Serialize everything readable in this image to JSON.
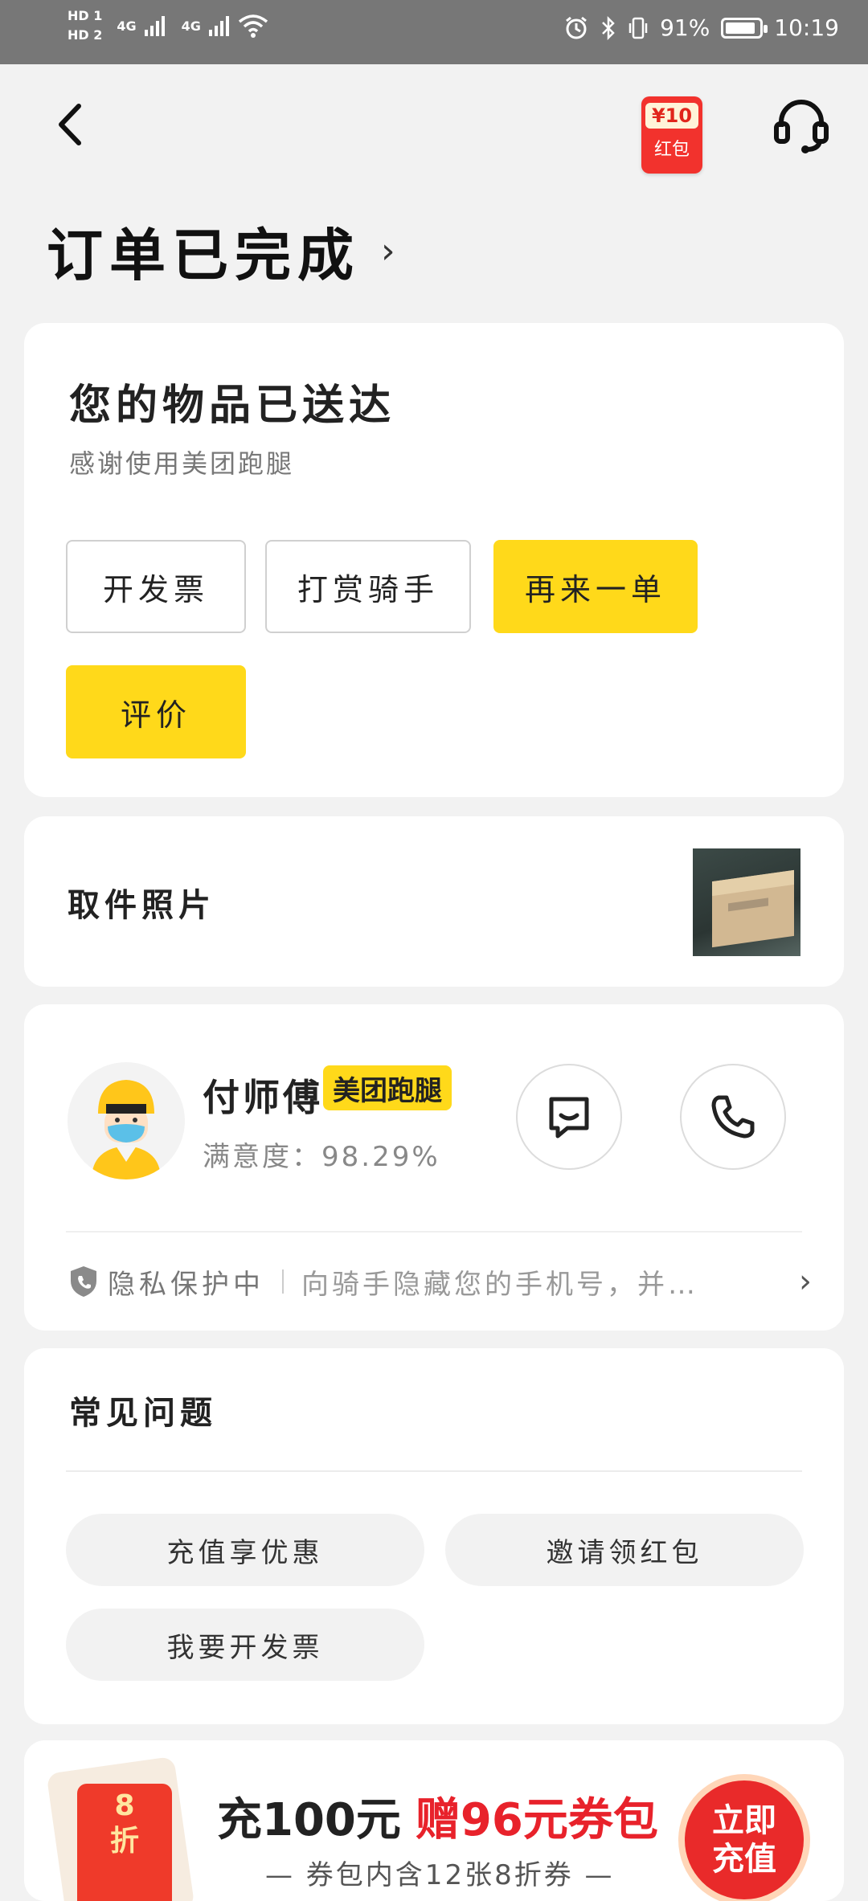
{
  "status_bar": {
    "hd1": "HD 1",
    "hd2": "HD 2",
    "sig1": "4G",
    "sig2": "4G",
    "battery_pct": "91%",
    "battery_level": 0.91,
    "time": "10:19"
  },
  "header": {
    "red_packet_amount": "¥10",
    "red_packet_label": "红包"
  },
  "page_title": "订单已完成",
  "delivery_card": {
    "title": "您的物品已送达",
    "subtitle": "感谢使用美团跑腿",
    "buttons": {
      "invoice": "开发票",
      "tip_rider": "打赏骑手",
      "reorder": "再来一单",
      "review": "评价"
    }
  },
  "pickup_card": {
    "title": "取件照片"
  },
  "rider_card": {
    "name": "付师傅",
    "badge": "美团跑腿",
    "satisfaction": "满意度：98.29%",
    "privacy_title": "隐私保护中",
    "privacy_text": "向骑手隐藏您的手机号，并…"
  },
  "faq_card": {
    "title": "常见问题",
    "items": [
      "充值享优惠",
      "邀请领红包",
      "我要开发票"
    ]
  },
  "promo_banner": {
    "coupon_line1": "8",
    "coupon_line2": "折",
    "main_black": "充100元",
    "main_red": "赠96元券包",
    "sub": "— 券包内含12张8折券 —",
    "button_line1": "立即",
    "button_line2": "充值"
  },
  "colors": {
    "accent_yellow": "#ffd91a",
    "promo_red": "#e8222b",
    "page_bg": "#f2f2f2"
  },
  "icons": [
    "back-arrow-icon",
    "red-packet-icon",
    "headset-icon",
    "chevron-right-icon",
    "message-icon",
    "phone-icon",
    "shield-icon"
  ]
}
